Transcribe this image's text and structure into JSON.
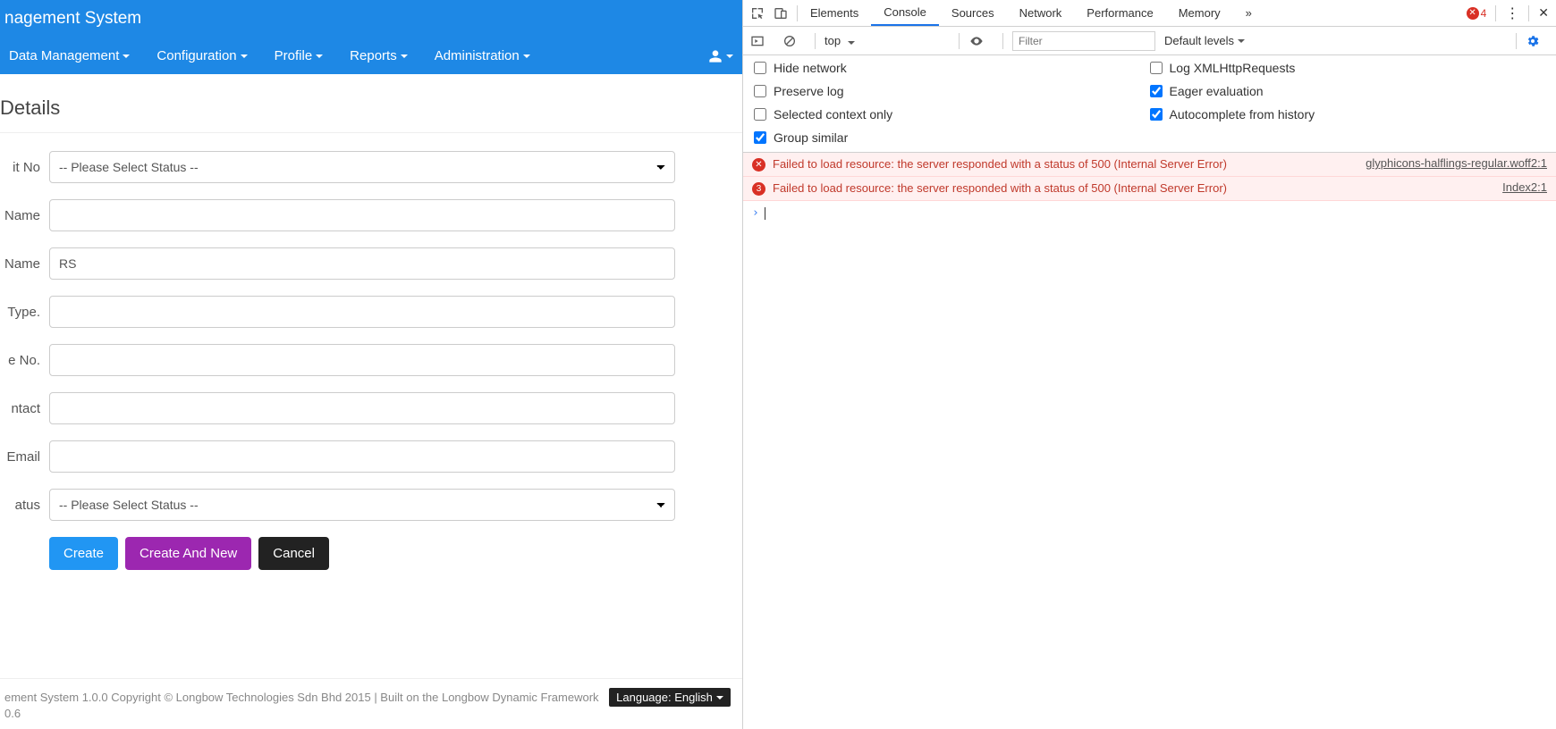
{
  "header": {
    "title": "nagement System"
  },
  "nav": {
    "items": [
      {
        "label": "Data Management"
      },
      {
        "label": "Configuration"
      },
      {
        "label": "Profile"
      },
      {
        "label": "Reports"
      },
      {
        "label": "Administration"
      }
    ]
  },
  "section": {
    "title": "Details"
  },
  "form": {
    "fields": [
      {
        "label": "it No",
        "type": "select",
        "value": "-- Please Select Status --"
      },
      {
        "label": "Name",
        "type": "text",
        "value": ""
      },
      {
        "label": "Name",
        "type": "text",
        "value": "RS"
      },
      {
        "label": "Type.",
        "type": "text",
        "value": ""
      },
      {
        "label": "e No.",
        "type": "text",
        "value": ""
      },
      {
        "label": "ntact",
        "type": "text",
        "value": ""
      },
      {
        "label": "Email",
        "type": "text",
        "value": ""
      },
      {
        "label": "atus",
        "type": "select",
        "value": "-- Please Select Status --"
      }
    ],
    "buttons": {
      "create": "Create",
      "create_new": "Create And New",
      "cancel": "Cancel"
    }
  },
  "footer": {
    "text": "ement System 1.0.0 Copyright © Longbow Technologies Sdn Bhd 2015 | Built on the Longbow Dynamic Framework",
    "version": "0.6",
    "lang_label": "Language: English"
  },
  "devtools": {
    "tabs": [
      "Elements",
      "Console",
      "Sources",
      "Network",
      "Performance",
      "Memory"
    ],
    "active_tab": "Console",
    "error_count": "4",
    "toolbar": {
      "context": "top",
      "filter_placeholder": "Filter",
      "levels": "Default levels"
    },
    "settings": {
      "col1": [
        {
          "label": "Hide network",
          "checked": false
        },
        {
          "label": "Preserve log",
          "checked": false
        },
        {
          "label": "Selected context only",
          "checked": false
        },
        {
          "label": "Group similar",
          "checked": true
        }
      ],
      "col2": [
        {
          "label": "Log XMLHttpRequests",
          "checked": false
        },
        {
          "label": "Eager evaluation",
          "checked": true
        },
        {
          "label": "Autocomplete from history",
          "checked": true
        }
      ]
    },
    "messages": [
      {
        "badge": "✕",
        "text": "Failed to load resource: the server responded with a status of 500 (Internal Server Error)",
        "source": "glyphicons-halflings-regular.woff2:1"
      },
      {
        "badge": "3",
        "text": "Failed to load resource: the server responded with a status of 500 (Internal Server Error)",
        "source": "Index2:1"
      }
    ]
  }
}
